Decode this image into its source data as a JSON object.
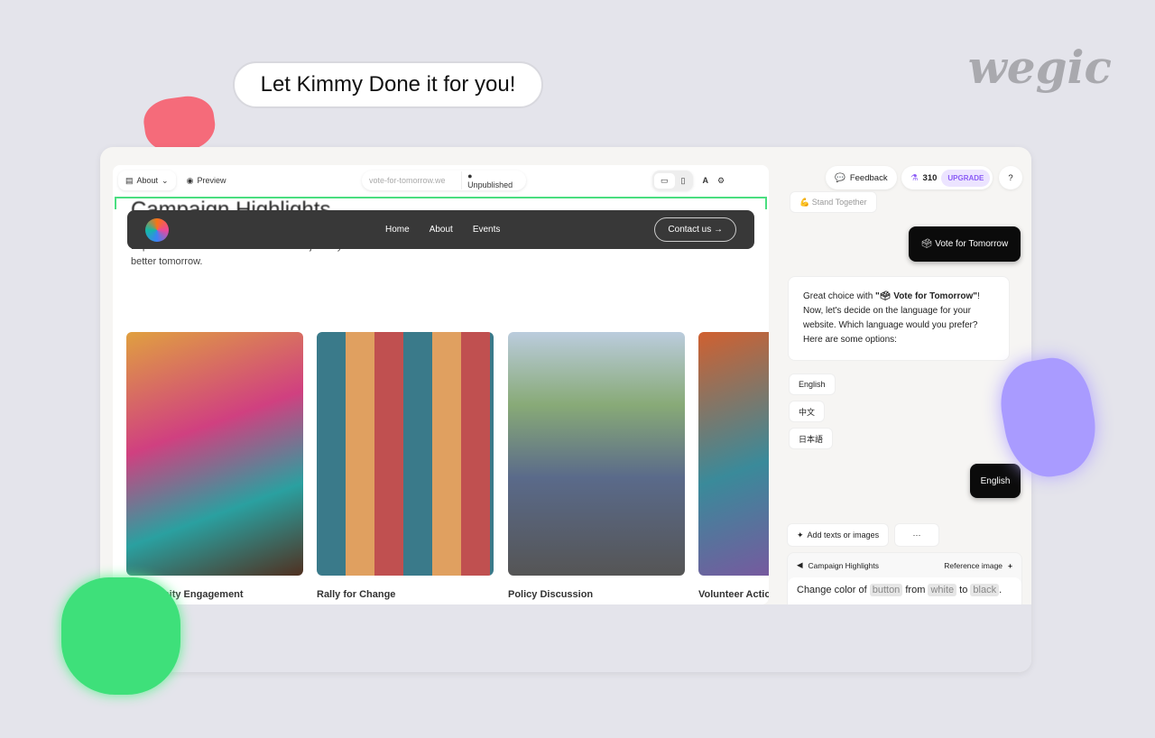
{
  "promo": {
    "bubble": "Let Kimmy Done it for you!",
    "brand": "wegic"
  },
  "toolbar": {
    "page_select": "About",
    "preview": "Preview",
    "url": "vote-for-tomorrow.we",
    "status": "Unpublished"
  },
  "site": {
    "heading": "Campaign Highlights",
    "body": "Experience the moments that define our journey towards a better tomorrow.",
    "nav": [
      "Home",
      "About",
      "Events"
    ],
    "contact": "Contact us →",
    "cards": [
      "Community Engagement",
      "Rally for Change",
      "Policy Discussion",
      "Volunteer Action"
    ]
  },
  "chat": {
    "feedback": "Feedback",
    "credits": "310",
    "upgrade": "UPGRADE",
    "help": "?",
    "prev_option": "💪 Stand Together",
    "user_msg1": "🗳 Vote for Tomorrow",
    "bot_msg_pre": "Great choice with ",
    "bot_msg_name": "\"🗳 Vote for Tomorrow\"",
    "bot_msg_post": "! Now, let's decide on the language for your website. Which language would you prefer? Here are some options:",
    "options": [
      "English",
      "中文",
      "日本語"
    ],
    "user_msg2": "English",
    "add": "Add texts or images",
    "more": "···",
    "section": "Campaign Highlights",
    "reference": "Reference image",
    "plus": "+",
    "prompt": {
      "a": "Change color of ",
      "t1": "button",
      "b": " from ",
      "t2": "white",
      "c": " to ",
      "t3": "black",
      "d": "."
    }
  },
  "colors": {
    "accent": "#8b5cf6",
    "nav": "#383838",
    "selection": "#4ade80"
  }
}
